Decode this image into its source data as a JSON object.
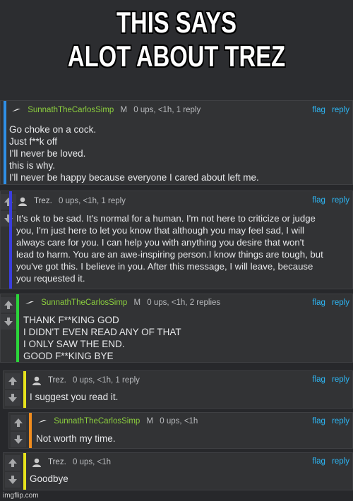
{
  "caption": {
    "line1": "THIS SAYS",
    "line2": "ALOT ABOUT TREZ"
  },
  "colors": {
    "bar_blue": "#2f8fe6",
    "bar_indigo": "#3a3de0",
    "bar_green": "#2bd43a",
    "bar_yellow": "#e6e21c",
    "bar_orange": "#f08c1e",
    "link": "#2db7f5",
    "username_green": "#8ccf3e"
  },
  "comments": [
    {
      "user": "SunnathTheCarlosSimp",
      "mod": "M",
      "meta": "0 ups, <1h, 1 reply",
      "flag": "flag",
      "reply": "reply",
      "lines": [
        "Go choke on a cock.",
        "Just f**k off",
        "I'll never be loved.",
        "this is why.",
        "I'll never be happy because everyone I cared about left me."
      ]
    },
    {
      "user": "Trez.",
      "meta": "0 ups, <1h, 1 reply",
      "flag": "flag",
      "reply": "reply",
      "lines": [
        "It's ok to be sad. It's normal for a human. I'm not here to criticize or judge",
        "you, I'm just here to let you know that although you may feel sad, I will",
        "always care for you. I can help you with anything you desire that won't",
        "lead to harm. You are an awe-inspiring person.I know things are tough, but",
        "you've got this. I believe in you. After this message, I will leave, because",
        "you requested it."
      ]
    },
    {
      "user": "SunnathTheCarlosSimp",
      "mod": "M",
      "meta": "0 ups, <1h, 2 replies",
      "flag": "flag",
      "reply": "reply",
      "lines": [
        "THANK F**KING GOD",
        "I DIDN'T EVEN READ ANY OF THAT",
        "I ONLY SAW THE END.",
        "GOOD F**KING BYE"
      ]
    },
    {
      "user": "Trez.",
      "meta": "0 ups, <1h, 1 reply",
      "flag": "flag",
      "reply": "reply",
      "lines": [
        "I suggest you read it."
      ]
    },
    {
      "user": "SunnathTheCarlosSimp",
      "mod": "M",
      "meta": "0 ups, <1h",
      "flag": "flag",
      "reply": "reply",
      "lines": [
        "Not worth my time."
      ]
    },
    {
      "user": "Trez.",
      "meta": "0 ups, <1h",
      "flag": "flag",
      "reply": "reply",
      "lines": [
        "Goodbye"
      ]
    }
  ],
  "watermark": "imgflip.com"
}
